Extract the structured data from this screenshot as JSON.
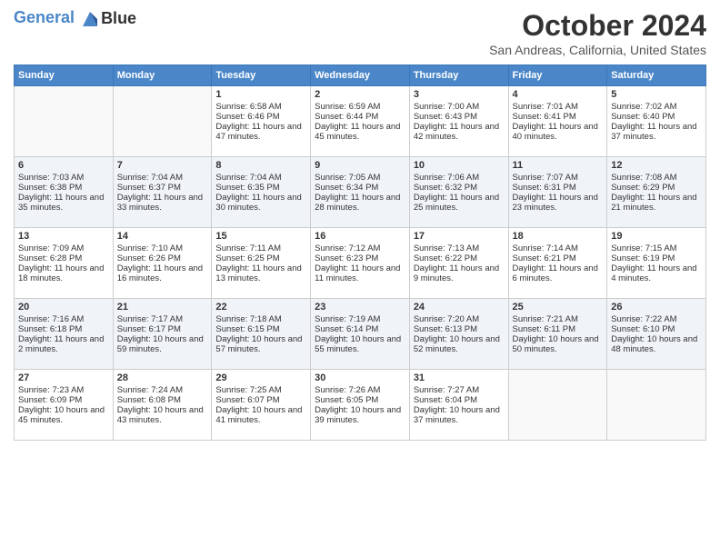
{
  "header": {
    "logo_line1": "General",
    "logo_line2": "Blue",
    "month_title": "October 2024",
    "location": "San Andreas, California, United States"
  },
  "days_of_week": [
    "Sunday",
    "Monday",
    "Tuesday",
    "Wednesday",
    "Thursday",
    "Friday",
    "Saturday"
  ],
  "weeks": [
    [
      {
        "day": "",
        "info": ""
      },
      {
        "day": "",
        "info": ""
      },
      {
        "day": "1",
        "info": "Sunrise: 6:58 AM\nSunset: 6:46 PM\nDaylight: 11 hours and 47 minutes."
      },
      {
        "day": "2",
        "info": "Sunrise: 6:59 AM\nSunset: 6:44 PM\nDaylight: 11 hours and 45 minutes."
      },
      {
        "day": "3",
        "info": "Sunrise: 7:00 AM\nSunset: 6:43 PM\nDaylight: 11 hours and 42 minutes."
      },
      {
        "day": "4",
        "info": "Sunrise: 7:01 AM\nSunset: 6:41 PM\nDaylight: 11 hours and 40 minutes."
      },
      {
        "day": "5",
        "info": "Sunrise: 7:02 AM\nSunset: 6:40 PM\nDaylight: 11 hours and 37 minutes."
      }
    ],
    [
      {
        "day": "6",
        "info": "Sunrise: 7:03 AM\nSunset: 6:38 PM\nDaylight: 11 hours and 35 minutes."
      },
      {
        "day": "7",
        "info": "Sunrise: 7:04 AM\nSunset: 6:37 PM\nDaylight: 11 hours and 33 minutes."
      },
      {
        "day": "8",
        "info": "Sunrise: 7:04 AM\nSunset: 6:35 PM\nDaylight: 11 hours and 30 minutes."
      },
      {
        "day": "9",
        "info": "Sunrise: 7:05 AM\nSunset: 6:34 PM\nDaylight: 11 hours and 28 minutes."
      },
      {
        "day": "10",
        "info": "Sunrise: 7:06 AM\nSunset: 6:32 PM\nDaylight: 11 hours and 25 minutes."
      },
      {
        "day": "11",
        "info": "Sunrise: 7:07 AM\nSunset: 6:31 PM\nDaylight: 11 hours and 23 minutes."
      },
      {
        "day": "12",
        "info": "Sunrise: 7:08 AM\nSunset: 6:29 PM\nDaylight: 11 hours and 21 minutes."
      }
    ],
    [
      {
        "day": "13",
        "info": "Sunrise: 7:09 AM\nSunset: 6:28 PM\nDaylight: 11 hours and 18 minutes."
      },
      {
        "day": "14",
        "info": "Sunrise: 7:10 AM\nSunset: 6:26 PM\nDaylight: 11 hours and 16 minutes."
      },
      {
        "day": "15",
        "info": "Sunrise: 7:11 AM\nSunset: 6:25 PM\nDaylight: 11 hours and 13 minutes."
      },
      {
        "day": "16",
        "info": "Sunrise: 7:12 AM\nSunset: 6:23 PM\nDaylight: 11 hours and 11 minutes."
      },
      {
        "day": "17",
        "info": "Sunrise: 7:13 AM\nSunset: 6:22 PM\nDaylight: 11 hours and 9 minutes."
      },
      {
        "day": "18",
        "info": "Sunrise: 7:14 AM\nSunset: 6:21 PM\nDaylight: 11 hours and 6 minutes."
      },
      {
        "day": "19",
        "info": "Sunrise: 7:15 AM\nSunset: 6:19 PM\nDaylight: 11 hours and 4 minutes."
      }
    ],
    [
      {
        "day": "20",
        "info": "Sunrise: 7:16 AM\nSunset: 6:18 PM\nDaylight: 11 hours and 2 minutes."
      },
      {
        "day": "21",
        "info": "Sunrise: 7:17 AM\nSunset: 6:17 PM\nDaylight: 10 hours and 59 minutes."
      },
      {
        "day": "22",
        "info": "Sunrise: 7:18 AM\nSunset: 6:15 PM\nDaylight: 10 hours and 57 minutes."
      },
      {
        "day": "23",
        "info": "Sunrise: 7:19 AM\nSunset: 6:14 PM\nDaylight: 10 hours and 55 minutes."
      },
      {
        "day": "24",
        "info": "Sunrise: 7:20 AM\nSunset: 6:13 PM\nDaylight: 10 hours and 52 minutes."
      },
      {
        "day": "25",
        "info": "Sunrise: 7:21 AM\nSunset: 6:11 PM\nDaylight: 10 hours and 50 minutes."
      },
      {
        "day": "26",
        "info": "Sunrise: 7:22 AM\nSunset: 6:10 PM\nDaylight: 10 hours and 48 minutes."
      }
    ],
    [
      {
        "day": "27",
        "info": "Sunrise: 7:23 AM\nSunset: 6:09 PM\nDaylight: 10 hours and 45 minutes."
      },
      {
        "day": "28",
        "info": "Sunrise: 7:24 AM\nSunset: 6:08 PM\nDaylight: 10 hours and 43 minutes."
      },
      {
        "day": "29",
        "info": "Sunrise: 7:25 AM\nSunset: 6:07 PM\nDaylight: 10 hours and 41 minutes."
      },
      {
        "day": "30",
        "info": "Sunrise: 7:26 AM\nSunset: 6:05 PM\nDaylight: 10 hours and 39 minutes."
      },
      {
        "day": "31",
        "info": "Sunrise: 7:27 AM\nSunset: 6:04 PM\nDaylight: 10 hours and 37 minutes."
      },
      {
        "day": "",
        "info": ""
      },
      {
        "day": "",
        "info": ""
      }
    ]
  ]
}
